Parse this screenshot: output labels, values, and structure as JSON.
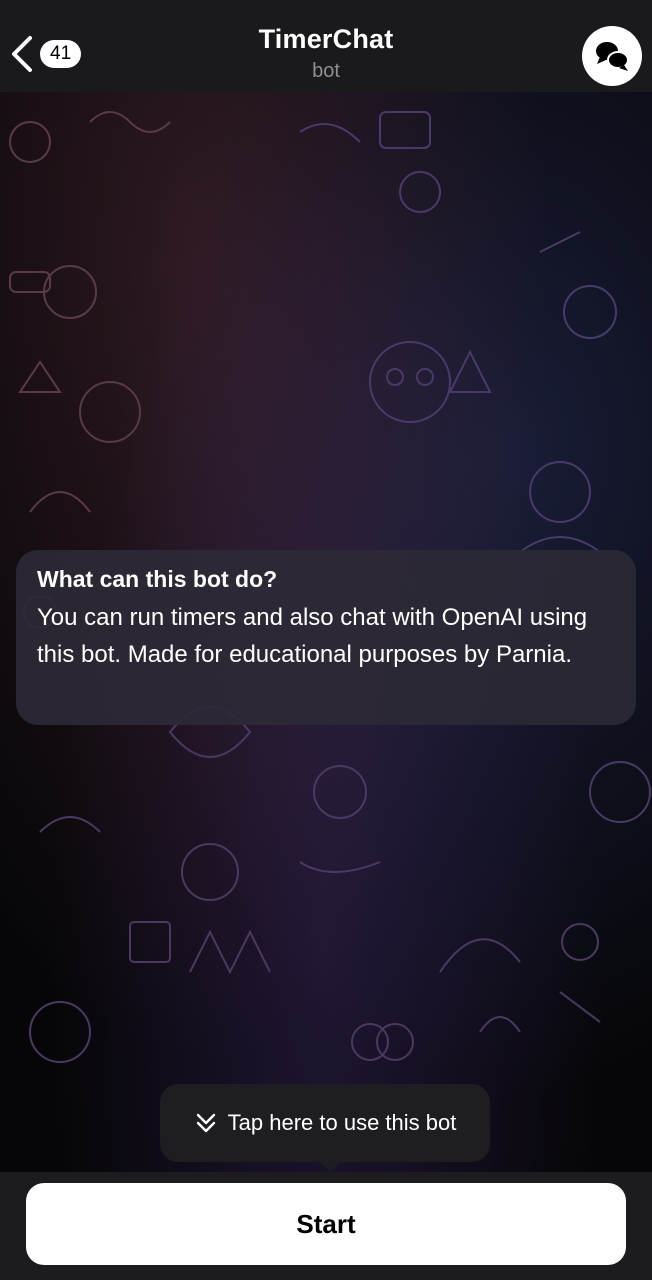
{
  "header": {
    "back_badge": "41",
    "title": "TimerChat",
    "subtitle": "bot",
    "icons": {
      "back": "chevron-left-icon",
      "avatar": "chat-bubbles-icon"
    }
  },
  "message": {
    "title": "What can this bot do?",
    "text": "You can run timers and also chat with OpenAI using this bot. Made for educational purposes by Parnia."
  },
  "tooltip": {
    "text": "Tap here to use this bot",
    "icon": "double-chevron-down-icon"
  },
  "start_button": {
    "label": "Start"
  },
  "colors": {
    "header_bg": "#1a1a1c",
    "bubble_bg": "#2c2936",
    "button_bg": "#ffffff",
    "subtitle": "#8e8e93"
  }
}
